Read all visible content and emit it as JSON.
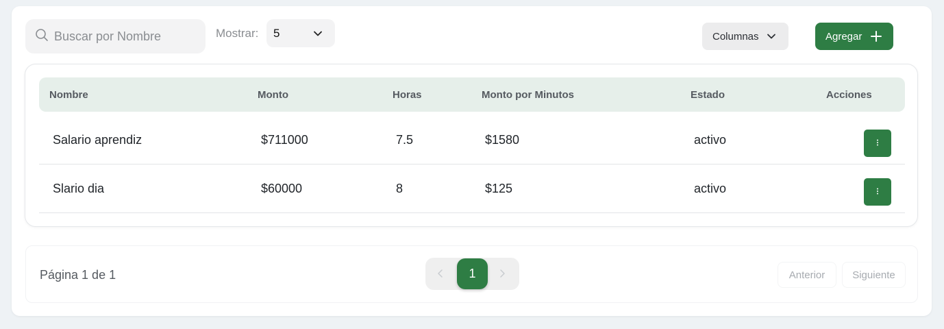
{
  "toolbar": {
    "search_placeholder": "Buscar por Nombre",
    "show_label": "Mostrar:",
    "show_value": "5",
    "columns_label": "Columnas",
    "add_label": "Agregar"
  },
  "table": {
    "headers": [
      "Nombre",
      "Monto",
      "Horas",
      "Monto por Minutos",
      "Estado",
      "Acciones"
    ],
    "rows": [
      {
        "nombre": "Salario aprendiz",
        "monto": "$711000",
        "horas": "7.5",
        "monto_min": "$1580",
        "estado": "activo"
      },
      {
        "nombre": "Slario dia",
        "monto": "$60000",
        "horas": "8",
        "monto_min": "$125",
        "estado": "activo"
      }
    ]
  },
  "pagination": {
    "info": "Página 1 de 1",
    "current": "1",
    "prev_label": "Anterior",
    "next_label": "Siguiente"
  },
  "colors": {
    "accent": "#2e7d44",
    "header_bg": "#e6efea",
    "page_bg": "#eef2f5"
  },
  "icons": {
    "search": "search-icon",
    "chevron": "chevron-down-icon",
    "plus": "plus-icon",
    "actions": "more-vertical-icon",
    "prev": "chevron-left-icon",
    "next": "chevron-right-icon"
  }
}
